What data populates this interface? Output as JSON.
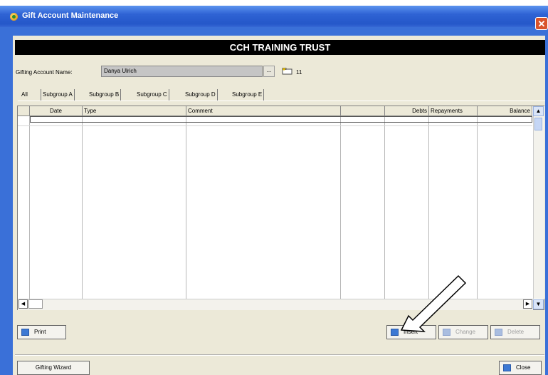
{
  "window": {
    "title": "Gift Account Maintenance",
    "close_glyph": "✕"
  },
  "banner": {
    "text": "CCH TRAINING TRUST"
  },
  "account": {
    "label": "Gifting Account Name:",
    "value": "Danya Ulrich",
    "browse_label": "...",
    "count": "11"
  },
  "tabs": [
    {
      "label": "All"
    },
    {
      "label": "Subgroup A"
    },
    {
      "label": "Subgroup B"
    },
    {
      "label": "Subgroup C"
    },
    {
      "label": "Subgroup D"
    },
    {
      "label": "Subgroup E"
    }
  ],
  "grid": {
    "columns": [
      "",
      "Date",
      "Type",
      "Comment",
      "",
      "Debts",
      "Repayments",
      "Balance"
    ],
    "rows": []
  },
  "buttons": {
    "print": "Print",
    "insert": "Insert",
    "change": "Change",
    "delete": "Delete",
    "gifting_wizard": "Gifting Wizard",
    "close": "Close"
  },
  "icons": {
    "app": "app-icon",
    "folder": "folder-icon",
    "arrow": "pointer-arrow-annotation"
  }
}
